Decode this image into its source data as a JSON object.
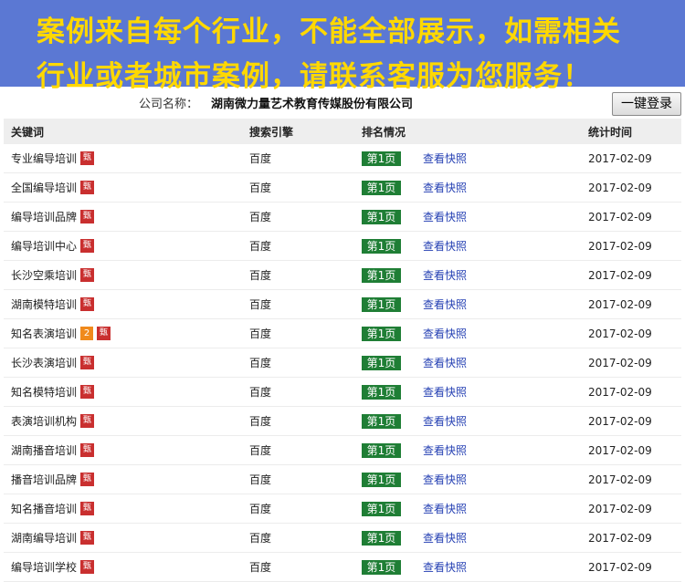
{
  "banner": {
    "line1": "案例来自每个行业，不能全部展示，如需相关",
    "line2": "行业或者城市案例，请联系客服为您服务！"
  },
  "company": {
    "label": "公司名称：",
    "name": "湖南微力量艺术教育传媒股份有限公司"
  },
  "login_button": "一键登录",
  "table": {
    "headers": {
      "keyword": "关键词",
      "engine": "搜索引擎",
      "rank": "排名情况",
      "date": "统计时间"
    },
    "rows": [
      {
        "keyword": "专业编导培训",
        "count": "",
        "badge": "甄",
        "engine": "百度",
        "rank": "第1页",
        "snapshot": "查看快照",
        "date": "2017-02-09"
      },
      {
        "keyword": "全国编导培训",
        "count": "",
        "badge": "甄",
        "engine": "百度",
        "rank": "第1页",
        "snapshot": "查看快照",
        "date": "2017-02-09"
      },
      {
        "keyword": "编导培训品牌",
        "count": "",
        "badge": "甄",
        "engine": "百度",
        "rank": "第1页",
        "snapshot": "查看快照",
        "date": "2017-02-09"
      },
      {
        "keyword": "编导培训中心",
        "count": "",
        "badge": "甄",
        "engine": "百度",
        "rank": "第1页",
        "snapshot": "查看快照",
        "date": "2017-02-09"
      },
      {
        "keyword": "长沙空乘培训",
        "count": "",
        "badge": "甄",
        "engine": "百度",
        "rank": "第1页",
        "snapshot": "查看快照",
        "date": "2017-02-09"
      },
      {
        "keyword": "湖南模特培训",
        "count": "",
        "badge": "甄",
        "engine": "百度",
        "rank": "第1页",
        "snapshot": "查看快照",
        "date": "2017-02-09"
      },
      {
        "keyword": "知名表演培训",
        "count": "2",
        "badge": "甄",
        "engine": "百度",
        "rank": "第1页",
        "snapshot": "查看快照",
        "date": "2017-02-09"
      },
      {
        "keyword": "长沙表演培训",
        "count": "",
        "badge": "甄",
        "engine": "百度",
        "rank": "第1页",
        "snapshot": "查看快照",
        "date": "2017-02-09"
      },
      {
        "keyword": "知名模特培训",
        "count": "",
        "badge": "甄",
        "engine": "百度",
        "rank": "第1页",
        "snapshot": "查看快照",
        "date": "2017-02-09"
      },
      {
        "keyword": "表演培训机构",
        "count": "",
        "badge": "甄",
        "engine": "百度",
        "rank": "第1页",
        "snapshot": "查看快照",
        "date": "2017-02-09"
      },
      {
        "keyword": "湖南播音培训",
        "count": "",
        "badge": "甄",
        "engine": "百度",
        "rank": "第1页",
        "snapshot": "查看快照",
        "date": "2017-02-09"
      },
      {
        "keyword": "播音培训品牌",
        "count": "",
        "badge": "甄",
        "engine": "百度",
        "rank": "第1页",
        "snapshot": "查看快照",
        "date": "2017-02-09"
      },
      {
        "keyword": "知名播音培训",
        "count": "",
        "badge": "甄",
        "engine": "百度",
        "rank": "第1页",
        "snapshot": "查看快照",
        "date": "2017-02-09"
      },
      {
        "keyword": "湖南编导培训",
        "count": "",
        "badge": "甄",
        "engine": "百度",
        "rank": "第1页",
        "snapshot": "查看快照",
        "date": "2017-02-09"
      },
      {
        "keyword": "编导培训学校",
        "count": "",
        "badge": "甄",
        "engine": "百度",
        "rank": "第1页",
        "snapshot": "查看快照",
        "date": "2017-02-09"
      }
    ]
  },
  "colors": {
    "banner_bg": "#5b78d3",
    "banner_text": "#ffd800",
    "rank_badge": "#1f7e35",
    "keyword_badge": "#c92f2f",
    "count_badge": "#f08a1c",
    "link": "#2540b3"
  }
}
